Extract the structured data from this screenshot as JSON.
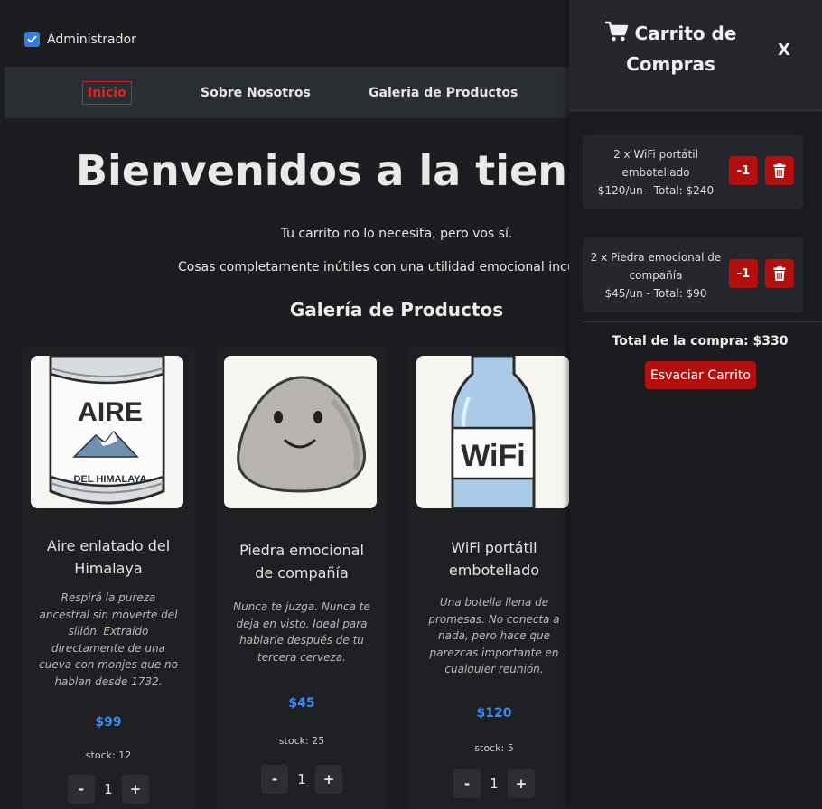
{
  "admin": {
    "label": "Administrador",
    "checked": true
  },
  "nav": {
    "items": [
      {
        "label": "Inicio",
        "active": true
      },
      {
        "label": "Sobre Nosotros",
        "active": false
      },
      {
        "label": "Galeria de Productos",
        "active": false
      }
    ]
  },
  "hero": {
    "title": "Bienvenidos a la tienda I",
    "tagline": "Tu carrito no lo necesita, pero vos sí.",
    "subtagline": "Cosas completamente inútiles con una utilidad emocional incuest"
  },
  "gallery": {
    "title": "Galería de Productos",
    "products": [
      {
        "image_icon": "canned-air-icon",
        "image_text": [
          "AIRE",
          "DEL HIMALAYA"
        ],
        "name": "Aire enlatado del Himalaya",
        "description": "Respirá la pureza ancestral sin moverte del sillón. Extraído directamente de una cueva con monjes que no hablan desde 1732.",
        "price": "$99",
        "stock": "stock: 12",
        "quantity": "1",
        "minus": "-",
        "plus": "+"
      },
      {
        "image_icon": "emotional-rock-icon",
        "name": "Piedra emocional de compañía",
        "description": "Nunca te juzga. Nunca te deja en visto. Ideal para hablarle después de tu tercera cerveza.",
        "price": "$45",
        "stock": "stock: 25",
        "quantity": "1",
        "minus": "-",
        "plus": "+"
      },
      {
        "image_icon": "wifi-bottle-icon",
        "image_text": [
          "WiFi"
        ],
        "name": "WiFi portátil embotellado",
        "description": "Una botella llena de promesas. No conecta a nada, pero hace que parezcas importante en cualquier reunión.",
        "price": "$120",
        "stock": "stock: 5",
        "quantity": "1",
        "minus": "-",
        "plus": "+"
      }
    ]
  },
  "cart": {
    "title": "Carrito de Compras",
    "close": "X",
    "items": [
      {
        "line1": "2 x WiFi portátil embotellado",
        "line2": "$120/un - Total: $240",
        "decrement": "-1",
        "delete_icon": "trash-icon"
      },
      {
        "line1": "2 x Piedra emocional de compañía",
        "line2": "$45/un - Total: $90",
        "decrement": "-1",
        "delete_icon": "trash-icon"
      }
    ],
    "total": "Total de la compra: $330",
    "empty_button": "Esvaciar Carrito"
  },
  "colors": {
    "background": "#1c1d21",
    "accent_blue": "#3d8bf0",
    "danger_red": "#b30f0f",
    "active_nav": "#e02424"
  }
}
